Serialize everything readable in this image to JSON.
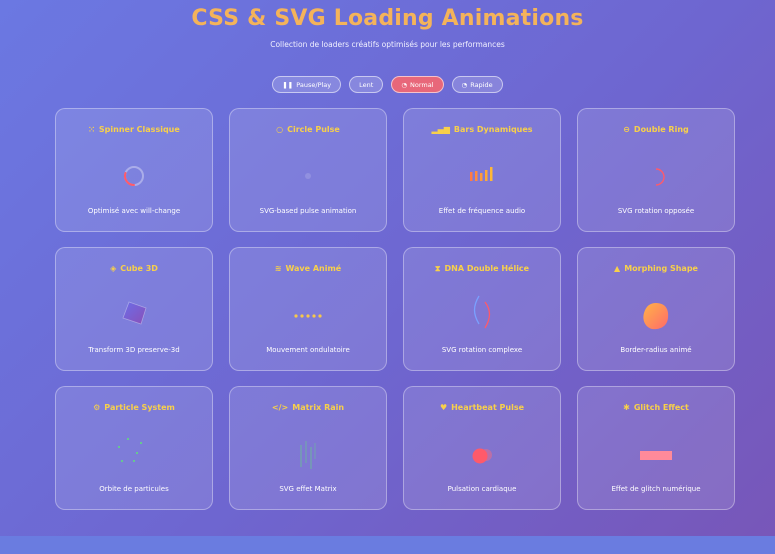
{
  "header": {
    "title": "CSS & SVG Loading Animations",
    "subtitle": "Collection de loaders créatifs optimisés pour les performances"
  },
  "controls": [
    {
      "label": "Pause/Play",
      "icon": "pause-icon",
      "active": false
    },
    {
      "label": "Lent",
      "icon": "",
      "active": false
    },
    {
      "label": "Normal",
      "icon": "gauge-icon",
      "active": true
    },
    {
      "label": "Rapide",
      "icon": "gauge-icon",
      "active": false
    }
  ],
  "colors": {
    "title": "#f4b35a",
    "card_title": "#f8d04a",
    "active_button": "#e8677a"
  },
  "cards": [
    {
      "title": "Spinner Classique",
      "icon": "spinner-icon",
      "desc": "Optimisé avec will-change"
    },
    {
      "title": "Circle Pulse",
      "icon": "circle-icon",
      "desc": "SVG-based pulse animation"
    },
    {
      "title": "Bars Dynamiques",
      "icon": "signal-bars-icon",
      "desc": "Effet de fréquence audio"
    },
    {
      "title": "Double Ring",
      "icon": "ring-icon",
      "desc": "SVG rotation opposée"
    },
    {
      "title": "Cube 3D",
      "icon": "cube-icon",
      "desc": "Transform 3D preserve-3d"
    },
    {
      "title": "Wave Animé",
      "icon": "wave-icon",
      "desc": "Mouvement ondulatoire"
    },
    {
      "title": "DNA Double Hélice",
      "icon": "hourglass-icon",
      "desc": "SVG rotation complexe"
    },
    {
      "title": "Morphing Shape",
      "icon": "shapes-icon",
      "desc": "Border-radius animé"
    },
    {
      "title": "Particle System",
      "icon": "gear-icon",
      "desc": "Orbite de particules"
    },
    {
      "title": "Matrix Rain",
      "icon": "code-icon",
      "desc": "SVG effet Matrix"
    },
    {
      "title": "Heartbeat Pulse",
      "icon": "heart-icon",
      "desc": "Pulsation cardiaque"
    },
    {
      "title": "Glitch Effect",
      "icon": "bug-icon",
      "desc": "Effet de glitch numérique"
    }
  ]
}
